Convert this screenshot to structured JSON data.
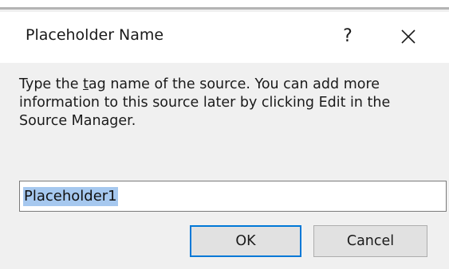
{
  "dialog": {
    "title": "Placeholder Name",
    "help_label": "?",
    "close_icon": "close-icon"
  },
  "message": {
    "before_access_key": "Type the ",
    "access_key": "t",
    "after_access_key": "ag name of the source. You can add more information to this source later by clicking Edit in the Source Manager."
  },
  "tag_input": {
    "value": "Placeholder1",
    "selected": true
  },
  "buttons": {
    "ok": "OK",
    "cancel": "Cancel"
  },
  "colors": {
    "background": "#f0f0f0",
    "selection": "#a6c8ef",
    "default_button_border": "#0078d7"
  }
}
